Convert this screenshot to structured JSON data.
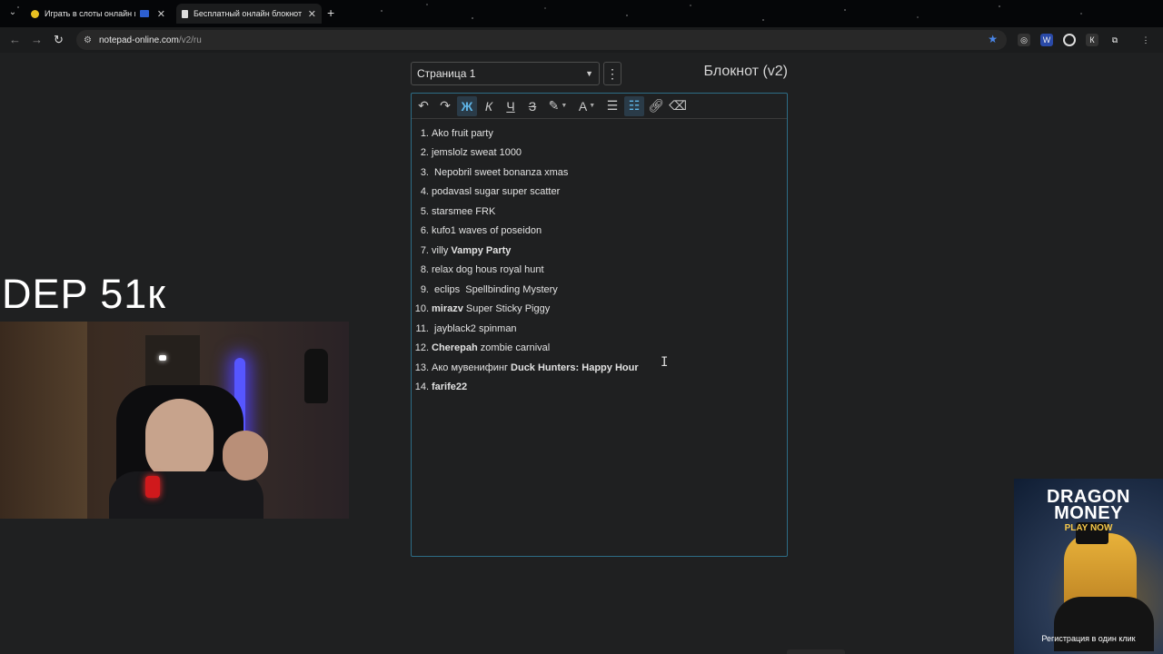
{
  "browser": {
    "tabs": [
      {
        "title": "Играть в слоты онлайн в",
        "active": false
      },
      {
        "title": "Бесплатный онлайн блокнот",
        "active": true
      }
    ],
    "new_tab": "+",
    "url_host": "notepad-online.com",
    "url_path": "/v2/ru"
  },
  "notepad": {
    "page_selector": "Страница 1",
    "app_title": "Блокнот (v2)",
    "toolbar": {
      "bold": "Ж",
      "italic": "К",
      "underline": "Ч",
      "strike": "З",
      "font_color": "A"
    },
    "items": [
      {
        "num": "1.",
        "plain": "Ako fruit party",
        "bold": "",
        "tail": ""
      },
      {
        "num": "2.",
        "plain": "jemslolz sweat 1000",
        "bold": "",
        "tail": ""
      },
      {
        "num": "3.",
        "plain": " Nepobril sweet bonanza xmas",
        "bold": "",
        "tail": ""
      },
      {
        "num": "4.",
        "plain": "podavasl sugar super scatter",
        "bold": "",
        "tail": ""
      },
      {
        "num": "5.",
        "plain": "starsmee FRK",
        "bold": "",
        "tail": ""
      },
      {
        "num": "6.",
        "plain": "kufo1 waves of poseidon",
        "bold": "",
        "tail": ""
      },
      {
        "num": "7.",
        "plain": "villy ",
        "bold": "Vampy Party",
        "tail": ""
      },
      {
        "num": "8.",
        "plain": "relax dog hous royal hunt",
        "bold": "",
        "tail": ""
      },
      {
        "num": "9.",
        "plain": " eclips  Spellbinding Mystery",
        "bold": "",
        "tail": ""
      },
      {
        "num": "10.",
        "plain": "",
        "bold": "mirazv",
        "tail": " Super Sticky Piggy"
      },
      {
        "num": "11.",
        "plain": " jayblack2 spinman",
        "bold": "",
        "tail": ""
      },
      {
        "num": "12.",
        "plain": "",
        "bold": "Cherepah",
        "tail": " zombie carnival"
      },
      {
        "num": "13.",
        "plain": "Ако мувенифинг ",
        "bold": "Duck Hunters: Happy Hour",
        "tail": ""
      },
      {
        "num": "14.",
        "plain": "",
        "bold": "farife22",
        "tail": ""
      }
    ]
  },
  "overlay": {
    "dep_text": "DEP 51к",
    "ad_title": "DRAGON MONEY",
    "ad_cta": "PLAY NOW",
    "ad_caption": "Регистрация в один клик"
  }
}
